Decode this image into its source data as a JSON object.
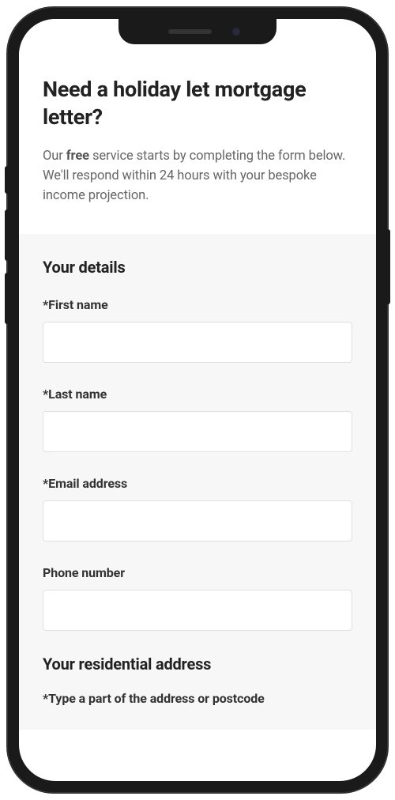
{
  "header": {
    "title": "Need a holiday let mortgage letter?",
    "intro_before": "Our ",
    "intro_bold": "free",
    "intro_after": " service starts by completing the form below. We'll respond within 24 hours with your bespoke income projection."
  },
  "form": {
    "section_title": "Your details",
    "fields": {
      "first_name": {
        "label": "*First name",
        "value": ""
      },
      "last_name": {
        "label": "*Last name",
        "value": ""
      },
      "email": {
        "label": "*Email address",
        "value": ""
      },
      "phone": {
        "label": "Phone number",
        "value": ""
      }
    },
    "address_section_title": "Your residential address",
    "address_field_label": "*Type a part of the address or postcode"
  }
}
